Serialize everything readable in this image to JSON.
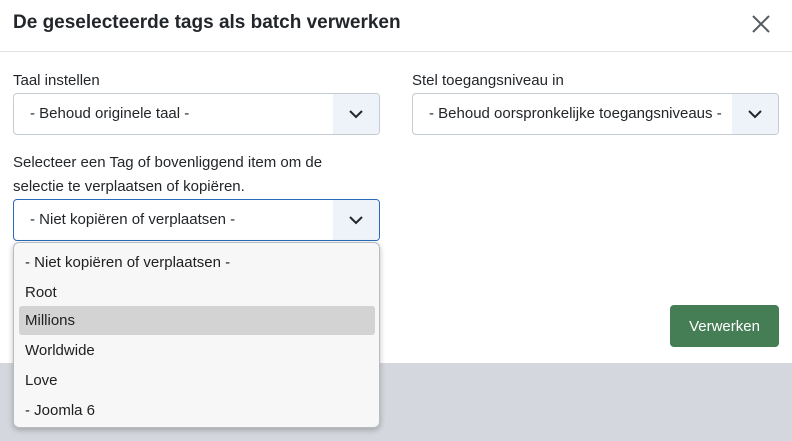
{
  "modal": {
    "title": "De geselecteerde tags als batch verwerken",
    "close_icon": "close-icon"
  },
  "language": {
    "label": "Taal instellen",
    "value": "- Behoud originele taal -"
  },
  "access": {
    "label": "Stel toegangsniveau in",
    "value": "- Behoud oorspronkelijke toegangsniveaus -"
  },
  "move_copy": {
    "label_line1": "Selecteer een Tag of bovenliggend item om de",
    "label_line2": "selectie te verplaatsen of kopiëren.",
    "value": "- Niet kopiëren of verplaatsen -",
    "options": [
      "- Niet kopiëren of verplaatsen -",
      "Root",
      "Millions",
      "Worldwide",
      "Love",
      "- Joomla 6"
    ],
    "highlighted_option": "Millions"
  },
  "actions": {
    "process_label": "Verwerken"
  },
  "colors": {
    "primary_button": "#457d54",
    "focus_border": "#2a69b8",
    "caret_background": "#eef3fa"
  }
}
